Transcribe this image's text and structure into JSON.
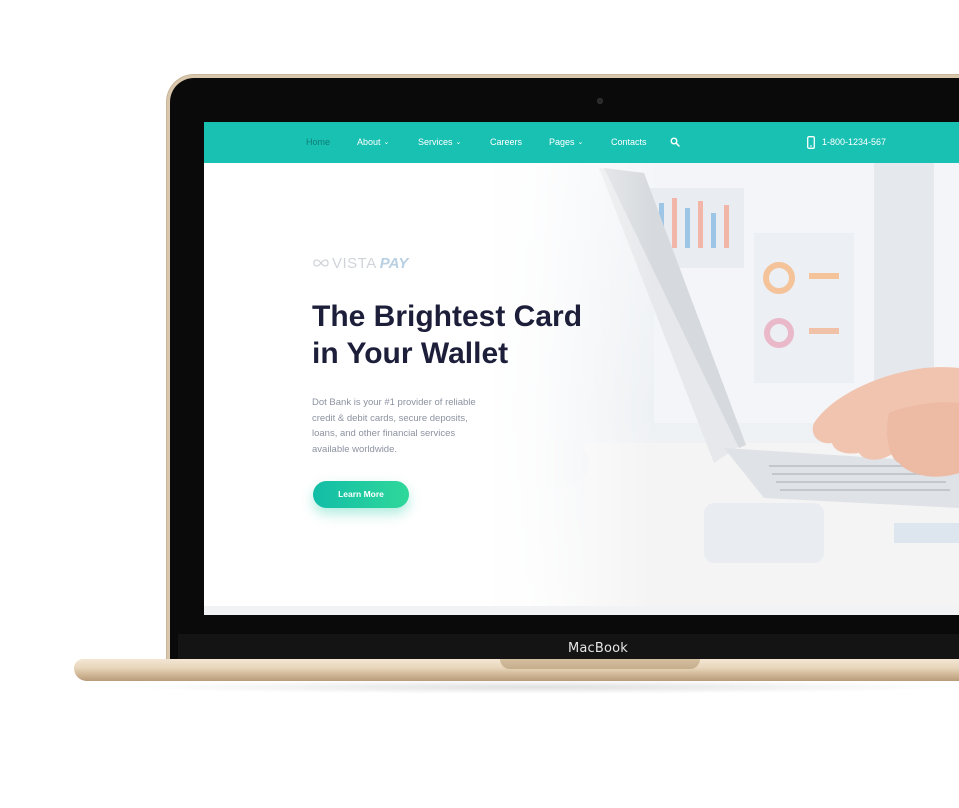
{
  "device": {
    "brand_label": "MacBook"
  },
  "nav": {
    "items": [
      {
        "label": "Home",
        "active": true,
        "dropdown": false
      },
      {
        "label": "About",
        "dropdown": true
      },
      {
        "label": "Services",
        "dropdown": true
      },
      {
        "label": "Careers",
        "dropdown": false
      },
      {
        "label": "Pages",
        "dropdown": true
      },
      {
        "label": "Contacts",
        "dropdown": false
      }
    ],
    "search_icon": "search-icon",
    "phone_icon": "mobile-phone-icon",
    "phone_number": "1-800-1234-567"
  },
  "hero": {
    "logo": {
      "text": "VISTA",
      "accent": "PAY"
    },
    "title_line1": "The Brightest Card",
    "title_line2": "in Your Wallet",
    "description": "Dot Bank is your #1 provider of reliable credit & debit cards, secure deposits, loans, and other financial services available worldwide.",
    "cta_label": "Learn More"
  },
  "colors": {
    "nav_bg": "#19c1b3",
    "title": "#1d1f3a",
    "cta_start": "#12bda7",
    "cta_end": "#2fd89a",
    "chassis": "#e8d6bb"
  }
}
